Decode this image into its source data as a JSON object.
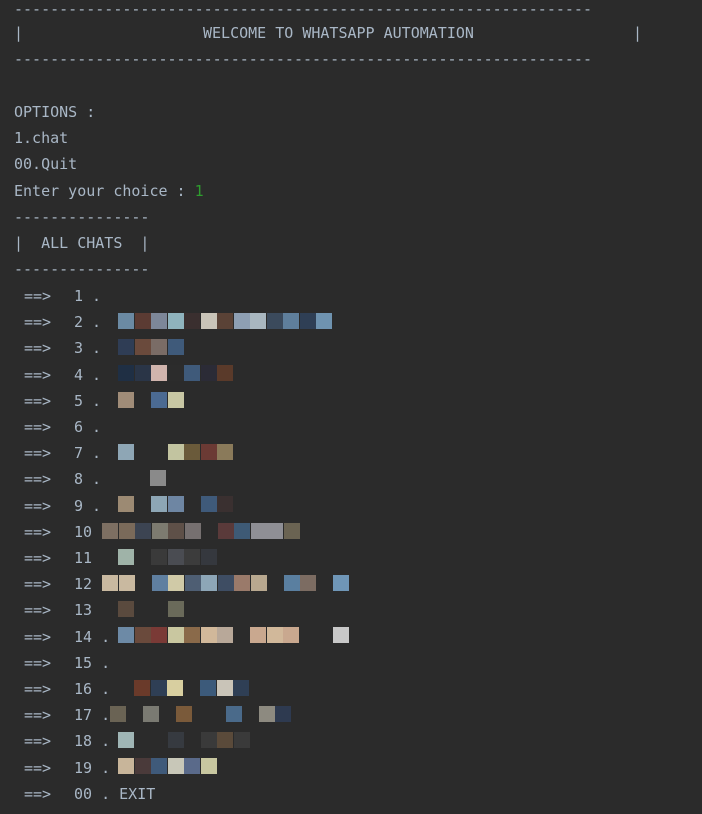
{
  "banner": {
    "rule_top": "----------------------------------------------------------------",
    "left_pipe": "|",
    "title": "WELCOME TO WHATSAPP AUTOMATION",
    "right_pipe": "|",
    "rule_bottom": "----------------------------------------------------------------"
  },
  "menu": {
    "header": "OPTIONS :",
    "option_1": "1.chat",
    "option_2": "00.Quit",
    "prompt": "Enter your choice : ",
    "input_value": "1"
  },
  "chats_box": {
    "rule_top": "---------------",
    "title": "|  ALL CHATS  |",
    "rule_bottom": "---------------"
  },
  "chat_list": [
    {
      "arrow": "==>",
      "num": "1 ."
    },
    {
      "arrow": "==>",
      "num": "2 ."
    },
    {
      "arrow": "==>",
      "num": "3 ."
    },
    {
      "arrow": "==>",
      "num": "4 ."
    },
    {
      "arrow": "==>",
      "num": "5 ."
    },
    {
      "arrow": "==>",
      "num": "6 ."
    },
    {
      "arrow": "==>",
      "num": "7 ."
    },
    {
      "arrow": "==>",
      "num": "8 ."
    },
    {
      "arrow": "==>",
      "num": "9 ."
    },
    {
      "arrow": "==>",
      "num": "10"
    },
    {
      "arrow": "==>",
      "num": "11"
    },
    {
      "arrow": "==>",
      "num": "12"
    },
    {
      "arrow": "==>",
      "num": "13"
    },
    {
      "arrow": "==>",
      "num": "14 ."
    },
    {
      "arrow": "==>",
      "num": "15 ."
    },
    {
      "arrow": "==>",
      "num": "16 ."
    },
    {
      "arrow": "==>",
      "num": "17 ."
    },
    {
      "arrow": "==>",
      "num": "18 ."
    },
    {
      "arrow": "==>",
      "num": "19 ."
    },
    {
      "arrow": "==>",
      "num": "00 . EXIT"
    }
  ],
  "colors": {
    "background": "#2b2b2b",
    "text": "#a9b7c6",
    "input": "#2e9e2e"
  }
}
